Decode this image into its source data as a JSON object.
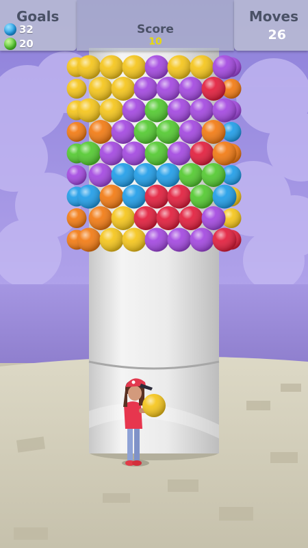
{
  "hud": {
    "goals_label": "Goals",
    "goals": [
      {
        "color": "blue",
        "count": "32"
      },
      {
        "color": "green",
        "count": "20"
      }
    ],
    "score_label": "Score",
    "score_value": "10",
    "moves_label": "Moves",
    "moves_value": "26"
  },
  "palette": {
    "blue": "#1f9de8",
    "green": "#52c92f",
    "red": "#e21d3c",
    "yellow": "#f5c51a",
    "purple": "#a347e0",
    "orange": "#f27a12",
    "sky": "#9b8ce0",
    "sea": "#9c8bd6",
    "floor": "#cbc6b2",
    "tower": "#e8e8e8"
  },
  "tower_rows": [
    [
      "yellow",
      "yellow",
      "yellow",
      "purple",
      "yellow",
      "yellow",
      "purple",
      "purple"
    ],
    [
      "yellow",
      "yellow",
      "purple",
      "purple",
      "purple",
      "red",
      "purple",
      "orange"
    ],
    [
      "yellow",
      "yellow",
      "purple",
      "green",
      "purple",
      "purple",
      "purple",
      "purple"
    ],
    [
      "orange",
      "purple",
      "green",
      "green",
      "purple",
      "orange",
      "orange",
      "blue"
    ],
    [
      "green",
      "purple",
      "purple",
      "green",
      "purple",
      "red",
      "orange",
      "orange"
    ],
    [
      "purple",
      "blue",
      "blue",
      "blue",
      "green",
      "green",
      "blue",
      "blue"
    ],
    [
      "blue",
      "orange",
      "blue",
      "red",
      "red",
      "green",
      "blue",
      "yellow"
    ],
    [
      "orange",
      "yellow",
      "red",
      "red",
      "red",
      "purple",
      "blue",
      "yellow"
    ],
    [
      "orange",
      "yellow",
      "yellow",
      "purple",
      "purple",
      "purple",
      "red",
      "red"
    ]
  ],
  "held_ball_color": "yellow"
}
